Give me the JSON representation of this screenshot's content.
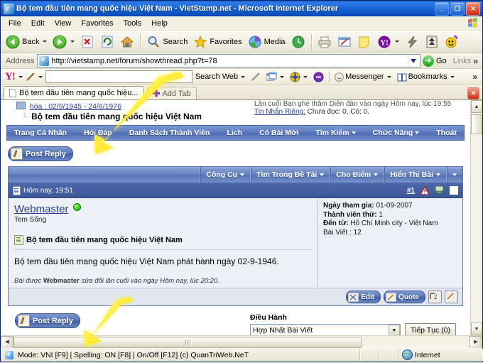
{
  "window": {
    "title": "Bộ tem đầu tiên mang quốc hiệu Việt Nam - VietStamp.net - Microsoft Internet Explorer",
    "minimize_label": "_",
    "restore_label": "❐",
    "close_label": "✕"
  },
  "menu": {
    "items": [
      {
        "label": "File"
      },
      {
        "label": "Edit"
      },
      {
        "label": "View"
      },
      {
        "label": "Favorites"
      },
      {
        "label": "Tools"
      },
      {
        "label": "Help"
      }
    ]
  },
  "toolbar": {
    "back_label": "Back",
    "search_label": "Search",
    "favorites_label": "Favorites",
    "media_label": "Media",
    "icons": [
      "back-icon",
      "forward-icon",
      "stop-icon",
      "refresh-icon",
      "home-icon",
      "search-icon",
      "favorites-icon",
      "media-icon",
      "history-icon",
      "print-icon",
      "edit-icon",
      "notes-icon",
      "yahoo-icon",
      "messenger-icon",
      "download-icon",
      "emoticon-icon"
    ]
  },
  "address": {
    "label": "Address",
    "url": "http://vietstamp.net/forum/showthread.php?t=78",
    "go_label": "Go",
    "links_label": "Links",
    "overflow_label": "»"
  },
  "yahoo_toolbar": {
    "logo": "Y!",
    "search_value": "",
    "search_web_label": "Search Web",
    "messenger_label": "Messenger",
    "bookmarks_label": "Bookmarks",
    "overflow_label": "»"
  },
  "tabs": {
    "active": {
      "label": "Bộ tem đầu tiên mang quốc hiệu..."
    },
    "add_label": "Add Tab",
    "close_label": "✕"
  },
  "page": {
    "breadcrumb_top": "hòa : 02/9/1945 - 24/6/1976",
    "breadcrumb_current": "Bộ tem đầu tiên mang quốc hiệu Việt Nam",
    "last_visit": "Lần cuối Bạn ghé thăm Diễn đàn vào ngày Hôm nay, lúc 19:55",
    "pm_link": "Tin Nhắn Riêng:",
    "pm_text": " Chưa đọc: 0, Có: 0.",
    "nav": [
      {
        "label": "Trang Cá Nhân",
        "has_caret": false
      },
      {
        "label": "Hỏi Đáp",
        "has_caret": false
      },
      {
        "label": "Danh Sách Thành Viên",
        "has_caret": false
      },
      {
        "label": "Lịch",
        "has_caret": false
      },
      {
        "label": "Có Bài Mới",
        "has_caret": false
      },
      {
        "label": "Tìm Kiếm",
        "has_caret": true
      },
      {
        "label": "Chức Năng",
        "has_caret": true
      },
      {
        "label": "Thoát",
        "has_caret": false
      }
    ],
    "post_reply_label": "Post Reply",
    "thread_tools": [
      {
        "label": "Công Cụ"
      },
      {
        "label": "Tìm Trong Đề Tài"
      },
      {
        "label": "Cho Điểm"
      },
      {
        "label": "Hiển Thị Bài"
      }
    ],
    "post": {
      "date": "Hôm nay, 19:51",
      "number": "#1",
      "username": "Webmaster",
      "user_title": "Tem Sống",
      "join_label": "Ngày tham gia:",
      "join_value": " 01-09-2007",
      "member_label": "Thành viên thứ:",
      "member_value": " 1",
      "from_label": "Đến từ:",
      "from_value": " Hồ Chí Minh city - Việt Nam",
      "posts_label": "Bài Viết : 12",
      "subject": "Bộ tem đầu tiên mang quốc hiệu Việt Nam",
      "body": "Bộ tem đầu tiên mang quốc hiệu Việt Nam phát hành ngày 02-9-1946.",
      "edit_note_pre": "Bài được ",
      "edit_note_user": "Webmaster",
      "edit_note_post": " sửa đổi lần cuối vào ngày Hôm nay, lúc 20:20.",
      "edit_label": "Edit",
      "quote_label": "Quote"
    },
    "footer": {
      "post_reply_label": "Post Reply",
      "moderation_label": "Điều Hành",
      "select_value": "Hợp Nhất Bài Viết",
      "continue_label": "Tiếp Tục (0)"
    }
  },
  "statusbar": {
    "message": "Mode: VNI [F9] | Spelling: ON [F8] | On/Off [F12] (c) QuanTriWeb.NeT",
    "zone": "Internet"
  },
  "colors": {
    "accent": "#3d5798",
    "title_bar": "#1a66d8",
    "link": "#2a3f8f",
    "arrow": "#ffee00"
  }
}
